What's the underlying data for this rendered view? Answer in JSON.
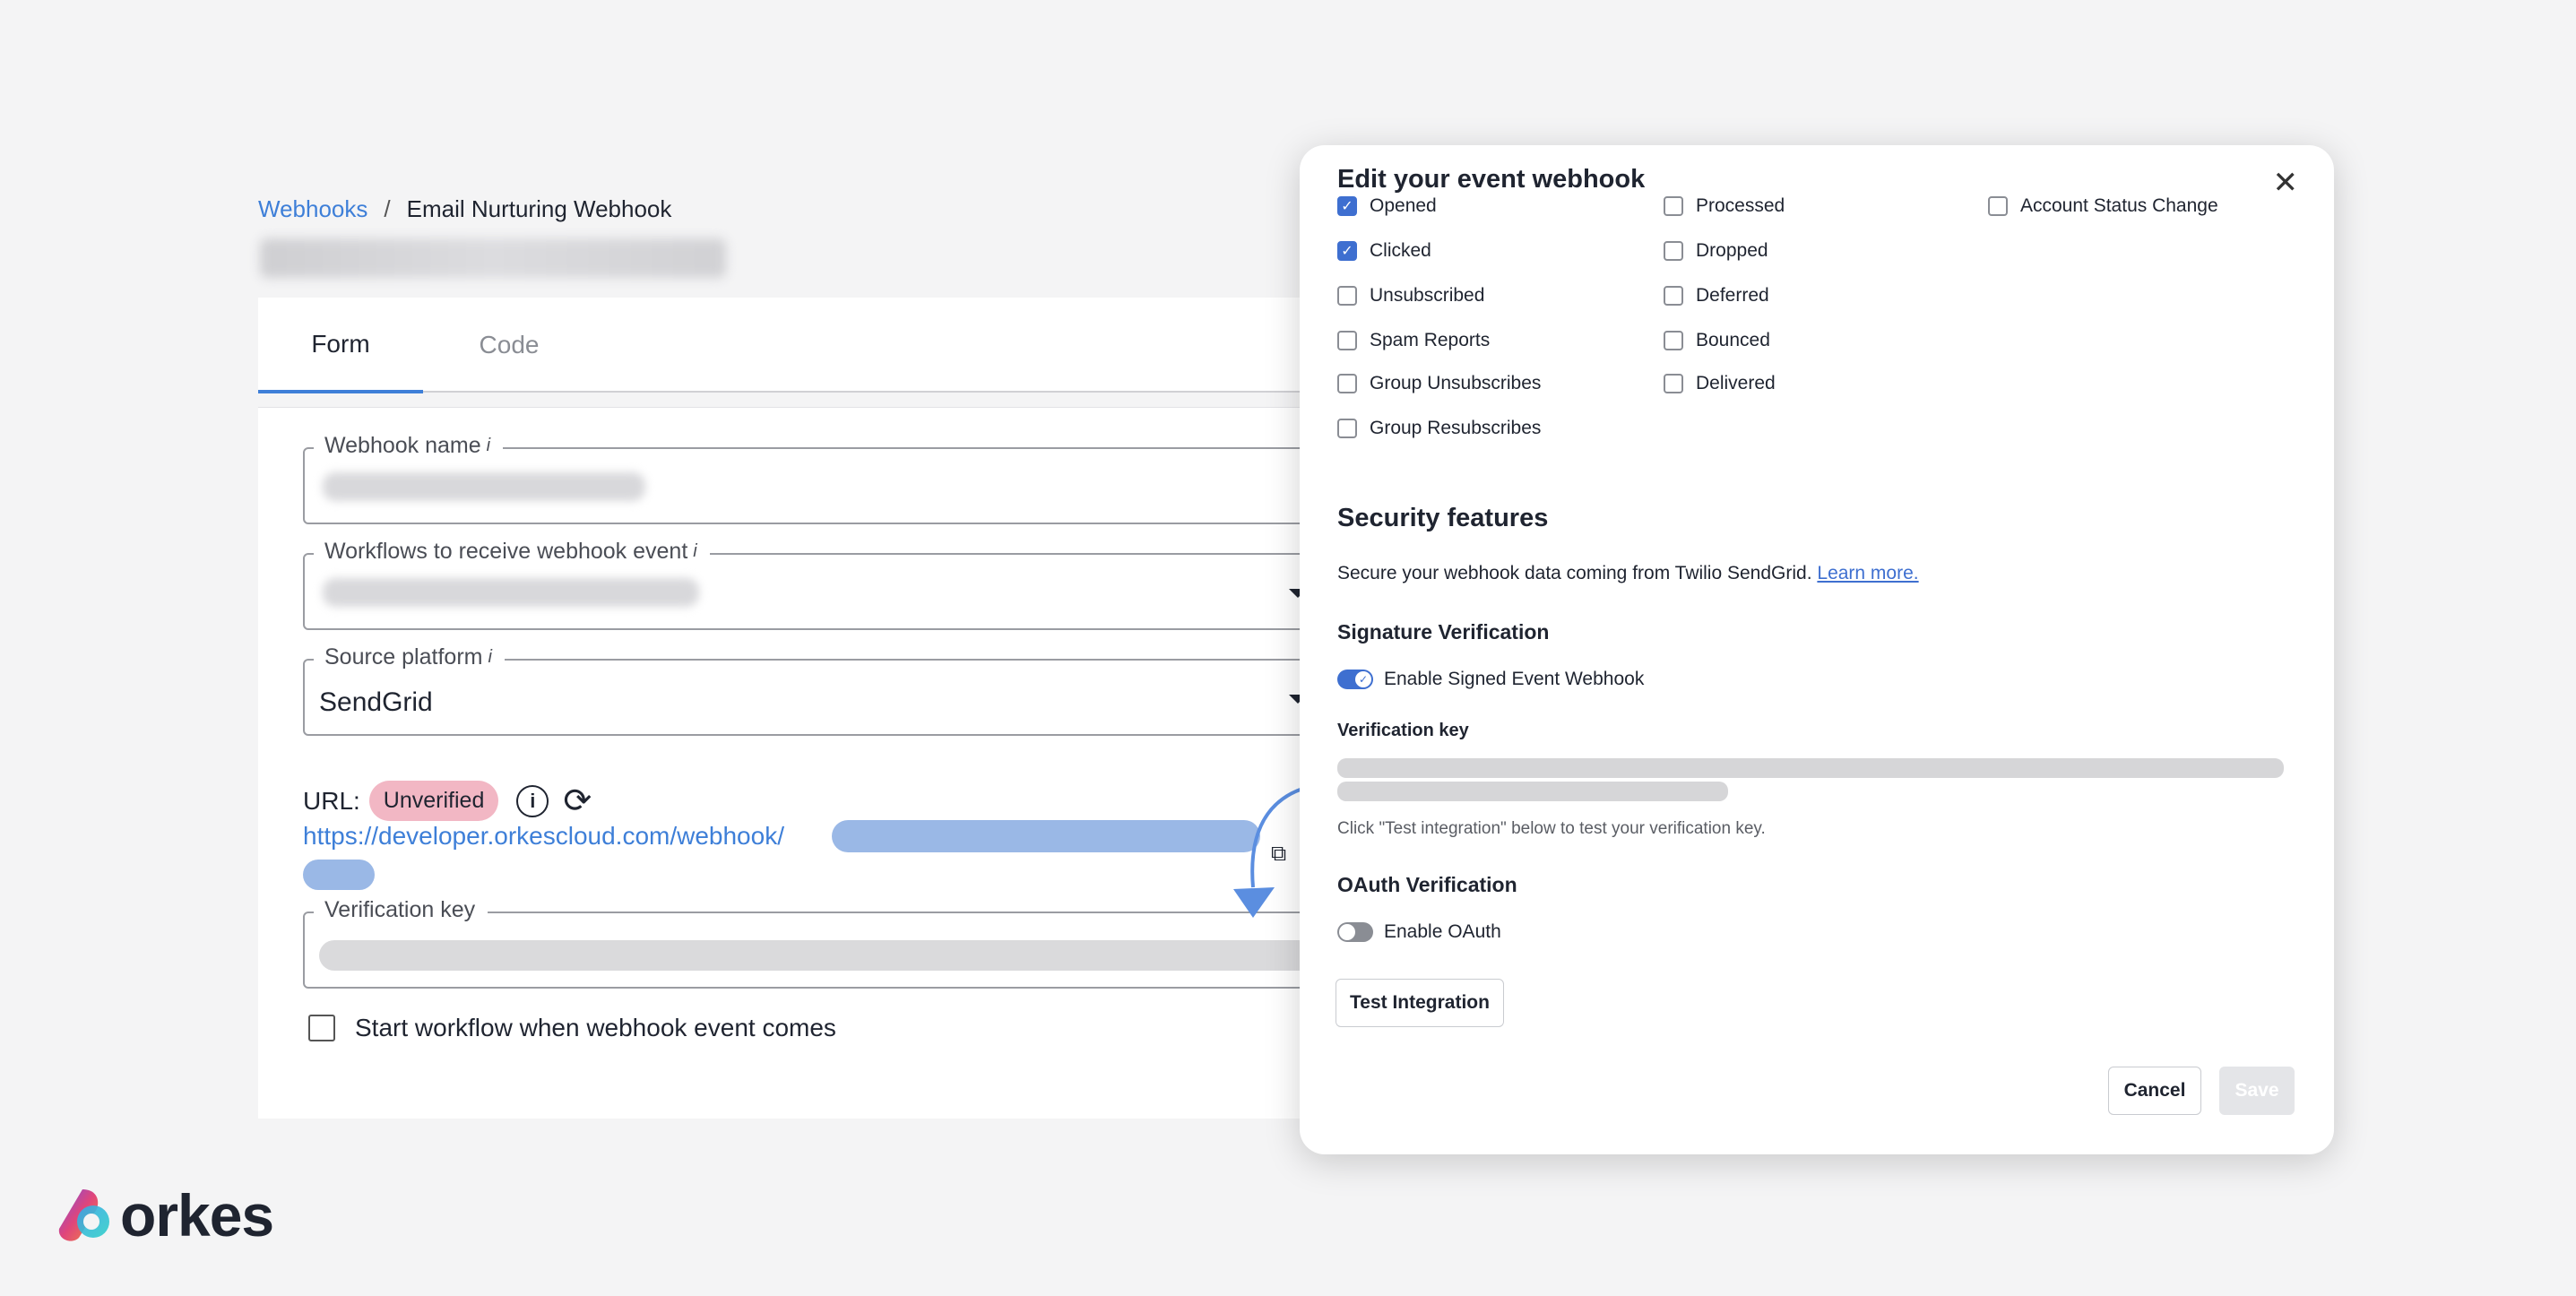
{
  "breadcrumb": {
    "parent": "Webhooks",
    "separator": "/",
    "current": "Email Nurturing Webhook"
  },
  "tabs": [
    {
      "label": "Form"
    },
    {
      "label": "Code"
    }
  ],
  "form": {
    "webhook_name_label": "Webhook name",
    "workflows_label": "Workflows to receive webhook event",
    "source_platform_label": "Source platform",
    "source_platform_value": "SendGrid",
    "url_label": "URL:",
    "url_status": "Unverified",
    "url_prefix": "https://developer.orkescloud.com/webhook/",
    "verification_key_label": "Verification key",
    "start_workflow_label": "Start workflow when webhook event comes",
    "info_glyph": "i"
  },
  "modal": {
    "title": "Edit your event webhook",
    "events": [
      {
        "label": "Opened",
        "checked": true
      },
      {
        "label": "Processed",
        "checked": false
      },
      {
        "label": "Account Status Change",
        "checked": false
      },
      {
        "label": "Clicked",
        "checked": true
      },
      {
        "label": "Dropped",
        "checked": false
      },
      {
        "label": "Unsubscribed",
        "checked": false
      },
      {
        "label": "Deferred",
        "checked": false
      },
      {
        "label": "Spam Reports",
        "checked": false
      },
      {
        "label": "Bounced",
        "checked": false
      },
      {
        "label": "Group Unsubscribes",
        "checked": false
      },
      {
        "label": "Delivered",
        "checked": false
      },
      {
        "label": "Group Resubscribes",
        "checked": false
      }
    ],
    "security_title": "Security features",
    "security_desc": "Secure your webhook data coming from Twilio SendGrid.",
    "learn_more": "Learn more.",
    "signature_title": "Signature Verification",
    "signed_toggle_label": "Enable Signed Event Webhook",
    "signed_toggle_on": true,
    "verification_key_label": "Verification key",
    "verification_hint": "Click \"Test integration\" below to test your verification key.",
    "oauth_title": "OAuth Verification",
    "oauth_toggle_label": "Enable OAuth",
    "oauth_toggle_on": false,
    "test_button": "Test Integration",
    "cancel_button": "Cancel",
    "save_button": "Save"
  },
  "logo": {
    "text": "orkes"
  },
  "colors": {
    "accent": "#3e7fd8",
    "badge": "#f2b7c4",
    "checkbox": "#3e6fd0"
  }
}
